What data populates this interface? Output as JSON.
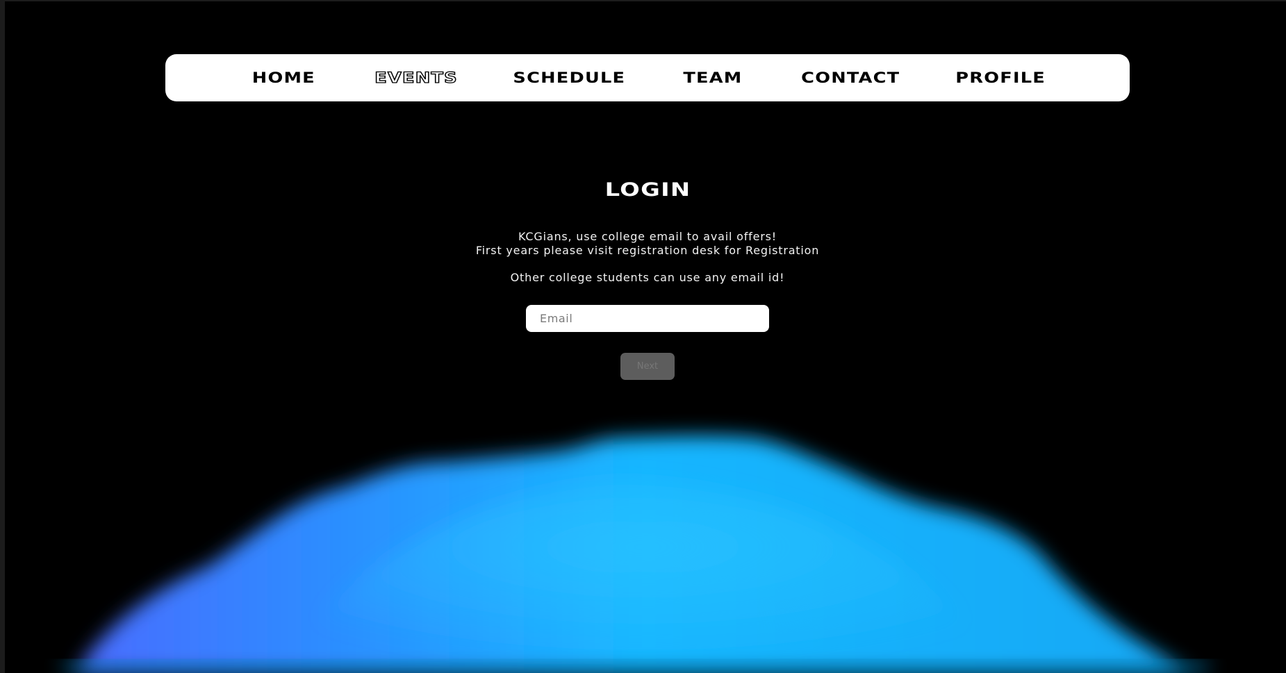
{
  "nav": {
    "items": [
      {
        "label": "HOME"
      },
      {
        "label": "EVENTS"
      },
      {
        "label": "SCHEDULE"
      },
      {
        "label": "TEAM"
      },
      {
        "label": "CONTACT"
      },
      {
        "label": "PROFILE"
      }
    ],
    "active": "EVENTS"
  },
  "login": {
    "title": "LOGIN",
    "line1": "KCGians, use college email to avail offers!",
    "line2": "First years please visit registration desk for Registration",
    "line3": "Other college students can use any email id!",
    "email_placeholder": "Email",
    "email_value": "",
    "next_label": "Next"
  },
  "colors": {
    "background": "#000000",
    "nav_bg": "#ffffff",
    "blob_primary": "#14b4ff",
    "blob_secondary": "#4a6cff",
    "button_disabled": "#5d5d5d"
  }
}
